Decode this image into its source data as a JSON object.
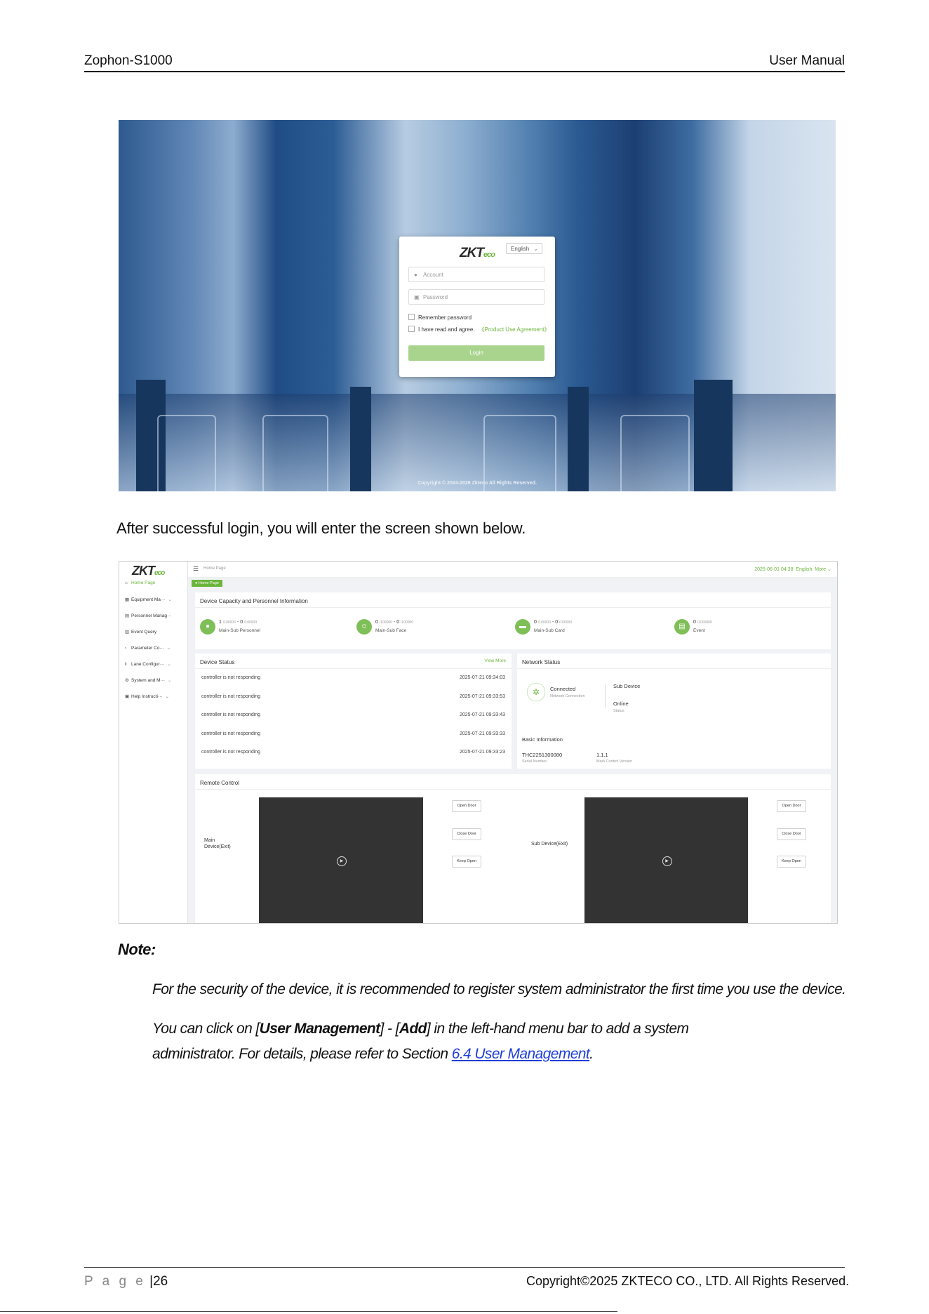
{
  "header": {
    "left": "Zophon-S1000",
    "right": "User Manual"
  },
  "login": {
    "language": "English",
    "logo_main": "ZKT",
    "logo_sub": "eco",
    "account_placeholder": "Account",
    "password_placeholder": "Password",
    "remember_label": "Remember password",
    "agree_label": "I have read and agree.",
    "agreement_link": "《Product Use Agreement》",
    "login_button": "Login",
    "copyright": "Copyright © 2024-2026 Zkteco All Rights Reserved."
  },
  "body": {
    "after_login": "After successful login, you will enter the screen shown below."
  },
  "dashboard": {
    "logo_main": "ZKT",
    "logo_sub": "eco",
    "sidebar": [
      {
        "label": "Home Page",
        "icon": "home-icon",
        "chevron": ""
      },
      {
        "label": "Equipment Ma···",
        "icon": "equipment-icon",
        "chevron": "⌄"
      },
      {
        "label": "Personnel Manag···",
        "icon": "personnel-icon",
        "chevron": ""
      },
      {
        "label": "Event Query",
        "icon": "event-icon",
        "chevron": ""
      },
      {
        "label": "Parameter Co···",
        "icon": "parameter-icon",
        "chevron": "⌄"
      },
      {
        "label": "Lane Configur···",
        "icon": "lane-icon",
        "chevron": "⌄"
      },
      {
        "label": "System and M···",
        "icon": "system-icon",
        "chevron": "⌄"
      },
      {
        "label": "Help Instructi···",
        "icon": "help-icon",
        "chevron": "⌄"
      }
    ],
    "breadcrumb": "Home Page",
    "datetime": "2025-06-01 04:38",
    "language": "English",
    "more": "More ⌄",
    "tab_tag": "● Home Page",
    "capacity": {
      "title": "Device Capacity and Personnel Information",
      "items": [
        {
          "value": "1",
          "v1": "/100000",
          "sep": "-",
          "value2": "0",
          "v2": "/100000",
          "label": "Main-Sub Personnel",
          "icon": "person-icon"
        },
        {
          "value": "0",
          "v1": "/100000",
          "sep": "-",
          "value2": "0",
          "v2": "/100000",
          "label": "Main-Sub Face",
          "icon": "face-icon"
        },
        {
          "value": "0",
          "v1": "/100000",
          "sep": "-",
          "value2": "0",
          "v2": "/100000",
          "label": "Main-Sub Card",
          "icon": "card-icon"
        },
        {
          "value": "0",
          "v1": "/1000000",
          "sep": "",
          "value2": "",
          "v2": "",
          "label": "Event",
          "icon": "event-doc-icon"
        }
      ]
    },
    "device_status": {
      "title": "Device Status",
      "view_more": "View More",
      "rows": [
        {
          "message": "controller is not responding",
          "time": "2025-07-21 09:34:03"
        },
        {
          "message": "controller is not responding",
          "time": "2025-07-21 09:33:53"
        },
        {
          "message": "controller is not responding",
          "time": "2025-07-21 09:33:43"
        },
        {
          "message": "controller is not responding",
          "time": "2025-07-21 09:33:33"
        },
        {
          "message": "controller is not responding",
          "time": "2025-07-21 09:33:23"
        }
      ]
    },
    "network": {
      "title": "Network Status",
      "connected": "Connected",
      "connected_sub": "Network Connection",
      "sub_device": "Sub Device",
      "online": "Online",
      "status": "Status",
      "basic_title": "Basic Information",
      "serial_value": "THC2251300080",
      "serial_label": "Serial Number",
      "version_value": "1.1.1",
      "version_label": "Main Control Version"
    },
    "remote": {
      "title": "Remote Control",
      "main_label": "Main Device(Exit)",
      "sub_label": "Sub Device(Exit)",
      "open": "Open Door",
      "close": "Close Door",
      "keep": "Keep Open"
    }
  },
  "note": {
    "title": "Note:",
    "line1": "For the security of the device, it is recommended to register system administrator the first time you use the device.",
    "line2_a": "You can click on [",
    "line2_b": "User Management",
    "line2_c": "] - [",
    "line2_d": "Add",
    "line2_e": "] in the left-hand menu bar to add a system",
    "line3_a": "administrator. For details, please refer to Section ",
    "line3_link": "6.4 User Management",
    "line3_b": "."
  },
  "footer": {
    "page_label": "P a g e",
    "page_sep": "|",
    "page_number": "26",
    "copyright": "Copyright©2025 ZKTECO CO., LTD. All Rights Reserved."
  }
}
